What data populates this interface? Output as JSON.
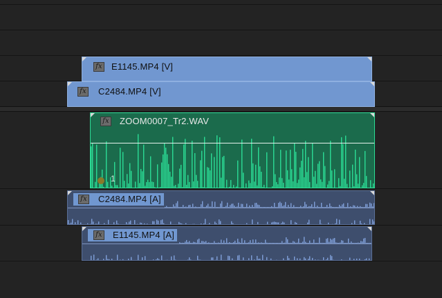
{
  "clips": {
    "v2": {
      "name": "E1145.MP4 [V]",
      "fx": "fx"
    },
    "v1": {
      "name": "C2484.MP4 [V]",
      "fx": "fx"
    },
    "a1": {
      "name": "ZOOM0007_Tr2.WAV",
      "fx": "fx",
      "marker": "1"
    },
    "a2": {
      "name": "C2484.MP4 [A]",
      "fx": "fx"
    },
    "a3": {
      "name": "E1145.MP4 [A]",
      "fx": "fx"
    }
  },
  "colors": {
    "video_clip": "#7197d0",
    "audio_clip": "#3e4e6d",
    "selected_audio": "#1b6b4c",
    "waveform_selected": "#2bdc95",
    "waveform": "#7f9fd8"
  }
}
